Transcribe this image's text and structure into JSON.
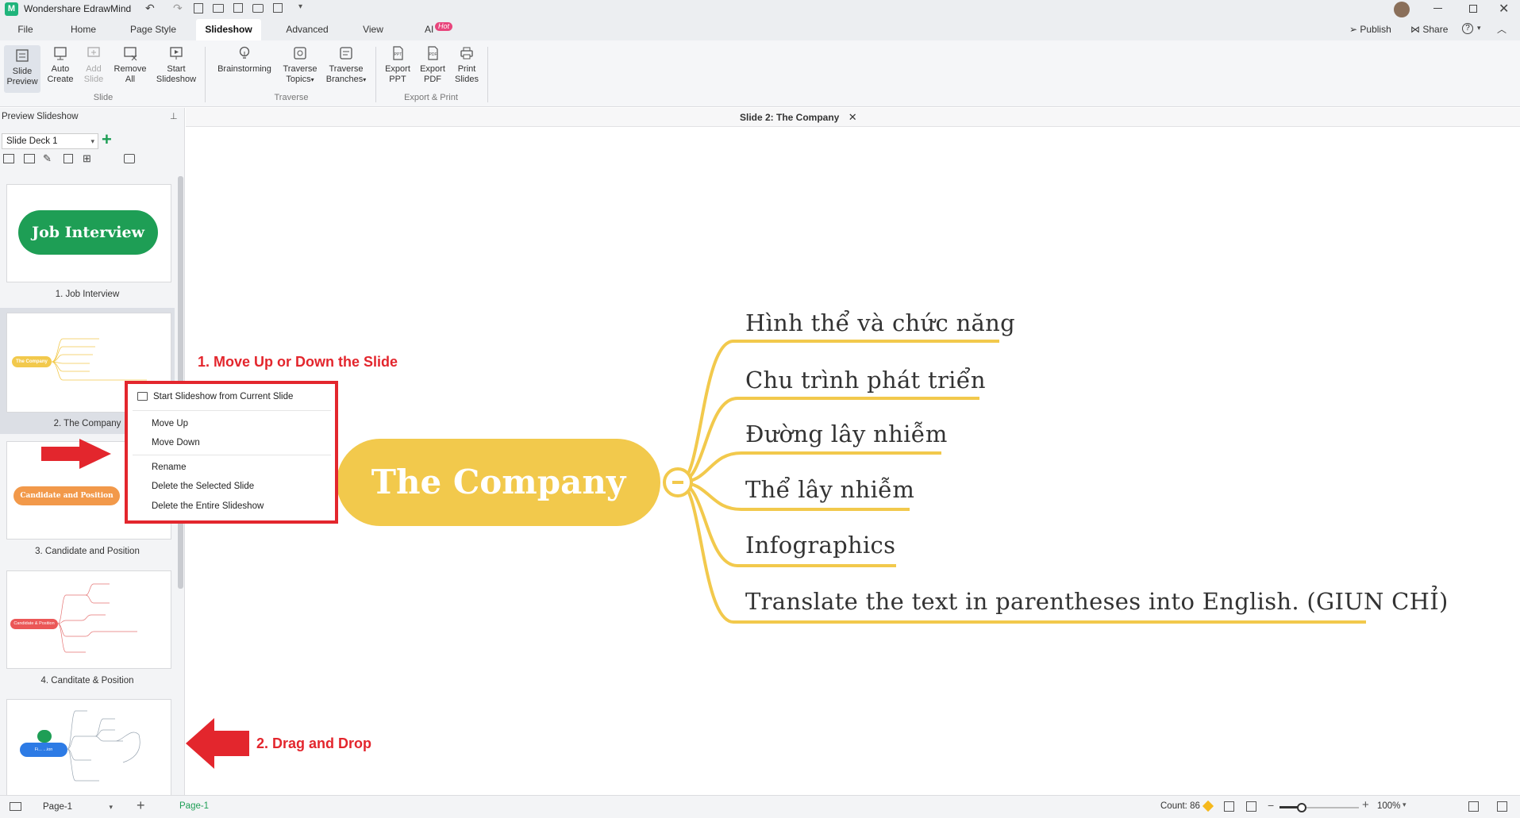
{
  "app": {
    "title": "Wondershare EdrawMind",
    "menu_tabs": [
      "File",
      "Home",
      "Page Style",
      "Slideshow",
      "Advanced",
      "View",
      "AI"
    ],
    "ai_badge": "Hot",
    "right_actions": {
      "publish": "Publish",
      "share": "Share",
      "help": "?"
    }
  },
  "ribbon": {
    "slide_group": {
      "label": "Slide",
      "buttons": [
        {
          "line1": "Slide",
          "line2": "Preview",
          "icon": "slide-preview-icon"
        },
        {
          "line1": "Auto",
          "line2": "Create",
          "icon": "auto-create-icon"
        },
        {
          "line1": "Add",
          "line2": "Slide",
          "icon": "add-slide-icon"
        },
        {
          "line1": "Remove",
          "line2": "All",
          "icon": "remove-all-icon"
        },
        {
          "line1": "Start",
          "line2": "Slideshow",
          "icon": "start-slideshow-icon"
        }
      ]
    },
    "traverse_group": {
      "label": "Traverse",
      "buttons": [
        {
          "line1": "Brainstorming",
          "line2": "",
          "icon": "lightbulb-icon"
        },
        {
          "line1": "Traverse",
          "line2": "Topics",
          "icon": "traverse-topics-icon"
        },
        {
          "line1": "Traverse",
          "line2": "Branches",
          "icon": "traverse-branches-icon"
        }
      ]
    },
    "export_group": {
      "label": "Export & Print",
      "buttons": [
        {
          "line1": "Export",
          "line2": "PPT",
          "icon": "ppt-icon"
        },
        {
          "line1": "Export",
          "line2": "PDF",
          "icon": "pdf-icon"
        },
        {
          "line1": "Print",
          "line2": "Slides",
          "icon": "print-icon"
        }
      ]
    }
  },
  "left_panel": {
    "title": "Preview Slideshow",
    "deck_select": "Slide Deck 1",
    "slides": [
      {
        "label": "1. Job Interview",
        "topic": "Job Interview"
      },
      {
        "label": "2. The Company",
        "topic": "The Company"
      },
      {
        "label": "3. Candidate and Position",
        "topic": "Candidate and Position"
      },
      {
        "label": "4. Canditate & Position",
        "topic": "Candidate & Position"
      },
      {
        "label": "",
        "topic": "Fi... ...ion"
      }
    ]
  },
  "context_menu": {
    "items": [
      "Start Slideshow from Current Slide",
      "Move Up",
      "Move Down",
      "Rename",
      "Delete the Selected Slide",
      "Delete the Entire Slideshow"
    ]
  },
  "annotations": {
    "move": "1. Move Up or Down the Slide",
    "drag": "2. Drag and Drop"
  },
  "document_tab": "Slide 2: The Company",
  "mindmap": {
    "central": "The Company",
    "central_color": "#f2c94c",
    "branch_color": "#f2c94c",
    "branches": [
      "Hình thể và chức năng",
      "Chu trình phát triển",
      "Đường lây nhiễm",
      "Thể lây nhiễm",
      "Infographics",
      "Translate the text in parentheses into English. (GIUN CHỈ)"
    ]
  },
  "status": {
    "page_select": "Page-1",
    "page_tab": "Page-1",
    "count": "Count: 86",
    "zoom": "100%"
  },
  "colors": {
    "accent_green": "#1e9e55",
    "annotation_red": "#e3262d"
  }
}
